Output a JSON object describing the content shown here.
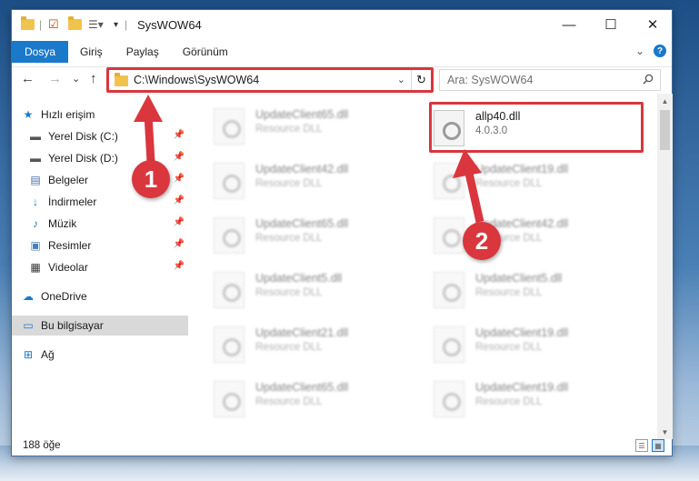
{
  "window": {
    "title": "SysWOW64",
    "minimize": "—",
    "maximize": "☐",
    "close": "✕"
  },
  "ribbon": {
    "tabs": [
      "Dosya",
      "Giriş",
      "Paylaş",
      "Görünüm"
    ],
    "expand": "⌄",
    "help": "?"
  },
  "nav": {
    "back": "←",
    "forward": "→",
    "recent": "⌄",
    "up": "↑",
    "address": "C:\\Windows\\SysWOW64",
    "address_drop": "⌄",
    "refresh": "↻",
    "search_placeholder": "Ara: SysWOW64"
  },
  "sidebar": {
    "quick_access": "Hızlı erişim",
    "items": [
      {
        "label": "Yerel Disk (C:)",
        "pinned": true
      },
      {
        "label": "Yerel Disk (D:)",
        "pinned": true
      },
      {
        "label": "Belgeler",
        "pinned": true
      },
      {
        "label": "İndirmeler",
        "pinned": true
      },
      {
        "label": "Müzik",
        "pinned": true
      },
      {
        "label": "Resimler",
        "pinned": true
      },
      {
        "label": "Videolar",
        "pinned": true
      }
    ],
    "onedrive": "OneDrive",
    "this_pc": "Bu bilgisayar",
    "network": "Ağ"
  },
  "files": {
    "highlighted": {
      "name": "allp40.dll",
      "desc": "4.0.3.0"
    },
    "left_column": [
      {
        "name": "UpdateClient65.dll",
        "desc": "Resource DLL"
      },
      {
        "name": "UpdateClient42.dll",
        "desc": "Resource DLL"
      },
      {
        "name": "UpdateClient65.dll",
        "desc": "Resource DLL"
      },
      {
        "name": "UpdateClient5.dll",
        "desc": "Resource DLL"
      },
      {
        "name": "UpdateClient21.dll",
        "desc": "Resource DLL"
      },
      {
        "name": "UpdateClient65.dll",
        "desc": "Resource DLL"
      }
    ],
    "right_column": [
      {
        "name": "UpdateClient19.dll",
        "desc": "Resource DLL"
      },
      {
        "name": "UpdateClient42.dll",
        "desc": "Resource DLL"
      },
      {
        "name": "UpdateClient5.dll",
        "desc": "Resource DLL"
      },
      {
        "name": "UpdateClient19.dll",
        "desc": "Resource DLL"
      },
      {
        "name": "UpdateClient19.dll",
        "desc": "Resource DLL"
      }
    ]
  },
  "status": {
    "count": "188 öğe"
  },
  "annotations": {
    "marker1": "1",
    "marker2": "2",
    "color": "#d9363e"
  }
}
